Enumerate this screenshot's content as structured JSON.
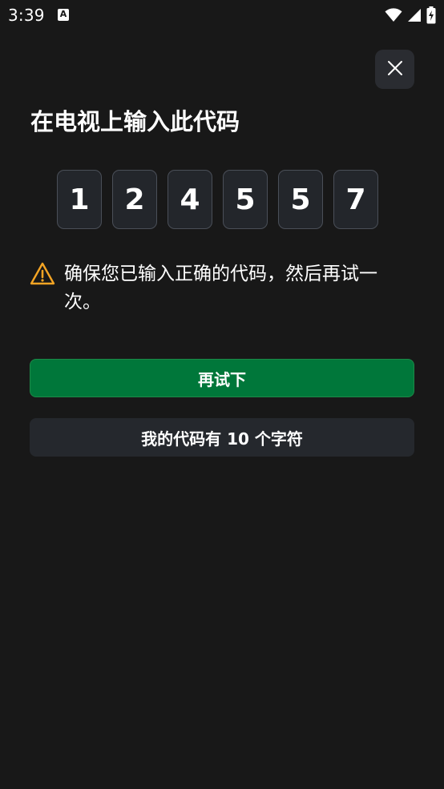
{
  "status_bar": {
    "time": "3:39",
    "app_icon_glyph": "A",
    "icons": [
      "wifi-icon",
      "signal-icon",
      "battery-charging-icon"
    ]
  },
  "header": {
    "close_icon": "close-icon"
  },
  "title": "在电视上输入此代码",
  "code_digits": [
    "1",
    "2",
    "4",
    "5",
    "5",
    "7"
  ],
  "warning": {
    "icon": "warning-icon",
    "text": "确保您已输入正确的代码，然后再试一次。"
  },
  "buttons": {
    "retry_label": "再试下",
    "ten_char_label": "我的代码有 10 个字符"
  },
  "colors": {
    "background": "#181818",
    "primary_button": "#00773a",
    "secondary_button": "#25282d",
    "warning_icon": "#f5a524",
    "code_box_border": "#4a4f58"
  }
}
